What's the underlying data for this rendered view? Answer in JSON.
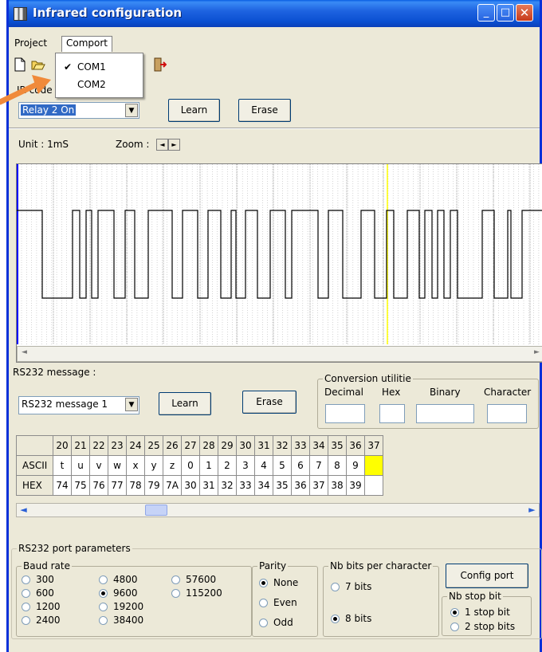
{
  "window": {
    "title": "Infrared configuration",
    "minimize_glyph": "_",
    "maximize_glyph": "□",
    "close_glyph": "✕"
  },
  "menu": {
    "items": [
      {
        "label": "Project"
      },
      {
        "label": "Comport"
      }
    ],
    "comport_dropdown": {
      "options": [
        {
          "label": "COM1",
          "checked": true
        },
        {
          "label": "COM2",
          "checked": false
        }
      ],
      "check_glyph": "✔"
    }
  },
  "toolbar": {
    "icons": [
      "new-file-icon",
      "open-folder-icon",
      "exit-icon"
    ]
  },
  "ir": {
    "code_label": "IR code",
    "code_label_visible": "IR code",
    "selected_code": "Relay 2 On",
    "learn_label": "Learn",
    "erase_label": "Erase",
    "unit_label": "Unit : 1mS",
    "zoom_label": "Zoom :",
    "zoom_left_glyph": "◄",
    "zoom_right_glyph": "►"
  },
  "rs232": {
    "message_label": "RS232 message :",
    "selected_message": "RS232 message 1",
    "learn_label": "Learn",
    "erase_label": "Erase",
    "conversion": {
      "title": "Conversion utilitie",
      "decimal_label": "Decimal",
      "hex_label": "Hex",
      "binary_label": "Binary",
      "character_label": "Character",
      "decimal_value": "",
      "hex_value": "",
      "binary_value": "",
      "character_value": ""
    },
    "table": {
      "columns": [
        "20",
        "21",
        "22",
        "23",
        "24",
        "25",
        "26",
        "27",
        "28",
        "29",
        "30",
        "31",
        "32",
        "33",
        "34",
        "35",
        "36",
        "37"
      ],
      "ascii_label": "ASCII",
      "hex_label": "HEX",
      "ascii": [
        "t",
        "u",
        "v",
        "w",
        "x",
        "y",
        "z",
        "0",
        "1",
        "2",
        "3",
        "4",
        "5",
        "6",
        "7",
        "8",
        "9",
        ""
      ],
      "hex": [
        "74",
        "75",
        "76",
        "77",
        "78",
        "79",
        "7A",
        "30",
        "31",
        "32",
        "33",
        "34",
        "35",
        "36",
        "37",
        "38",
        "39",
        ""
      ],
      "highlight_color": "#ffff00"
    }
  },
  "port": {
    "group_title": "RS232 port parameters",
    "baud": {
      "title": "Baud rate",
      "options": [
        "300",
        "600",
        "1200",
        "2400",
        "4800",
        "9600",
        "19200",
        "38400",
        "57600",
        "115200"
      ],
      "selected": "9600"
    },
    "parity": {
      "title": "Parity",
      "options": [
        "None",
        "Even",
        "Odd"
      ],
      "selected": "None"
    },
    "bits": {
      "title": "Nb bits per character",
      "options": [
        "7 bits",
        "8 bits"
      ],
      "selected": "8 bits"
    },
    "config_label": "Config port",
    "stop": {
      "title": "Nb stop bit",
      "options": [
        "1 stop bit",
        "2 stop bits"
      ],
      "selected": "1 stop bit"
    }
  },
  "colors": {
    "title_bar": "#0a4fd1",
    "window_bg": "#ece9d8",
    "signal_marker": "#ffff00",
    "start_marker": "#0000ff",
    "pointer": "#f08a3a"
  }
}
